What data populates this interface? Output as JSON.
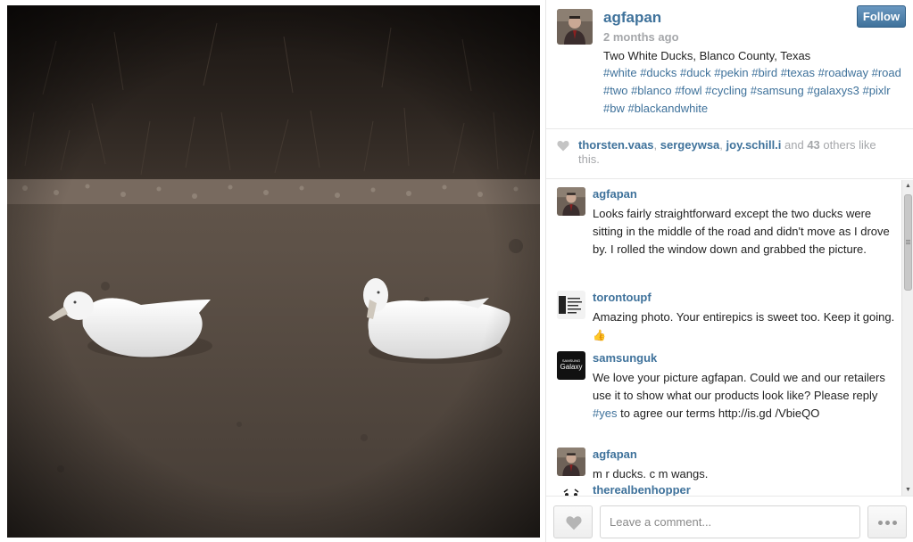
{
  "post": {
    "username": "agfapan",
    "time_ago": "2 months ago",
    "caption": "Two White Ducks, Blanco County, Texas",
    "hashtags": "#white #ducks #duck #pekin #bird #texas #roadway #road #two #blanco #fowl #cycling #samsung #galaxys3 #pixlr #bw #blackandwhite",
    "follow_label": "Follow"
  },
  "likes": {
    "user1": "thorsten.vaas",
    "sep1": ", ",
    "user2": "sergeywsa",
    "sep2": ", ",
    "user3": "joy.schill.i",
    "and": " and ",
    "count": "43",
    "others": " others like this."
  },
  "comments": [
    {
      "user": "agfapan",
      "text": "Looks fairly straightforward except the two ducks were sitting in the middle of the road and didn't move as I drove by. I rolled the window down and grabbed the picture."
    },
    {
      "user": "torontoupf",
      "text": "Amazing photo. Your entirepics is sweet too. Keep it going.",
      "emoji": "👍"
    },
    {
      "user": "samsunguk",
      "avatar_text_small": "SAMSUNG",
      "avatar_text": "Galaxy",
      "text_before": "We love your picture agfapan. Could we and our retailers use it to show what our products look like? Please reply ",
      "link": "#yes",
      "text_after": " to agree our terms http://is.gd /VbieQO"
    },
    {
      "user": "agfapan",
      "text": "m r ducks. c m wangs."
    },
    {
      "user": "therealbenhopper",
      "text": ""
    }
  ],
  "footer": {
    "comment_placeholder": "Leave a comment..."
  },
  "icons": {
    "heart": "heart-icon",
    "more": "more-icon"
  },
  "colors": {
    "link": "#3f729b",
    "muted": "#a5a7aa",
    "follow_bg": "#3f729b"
  }
}
